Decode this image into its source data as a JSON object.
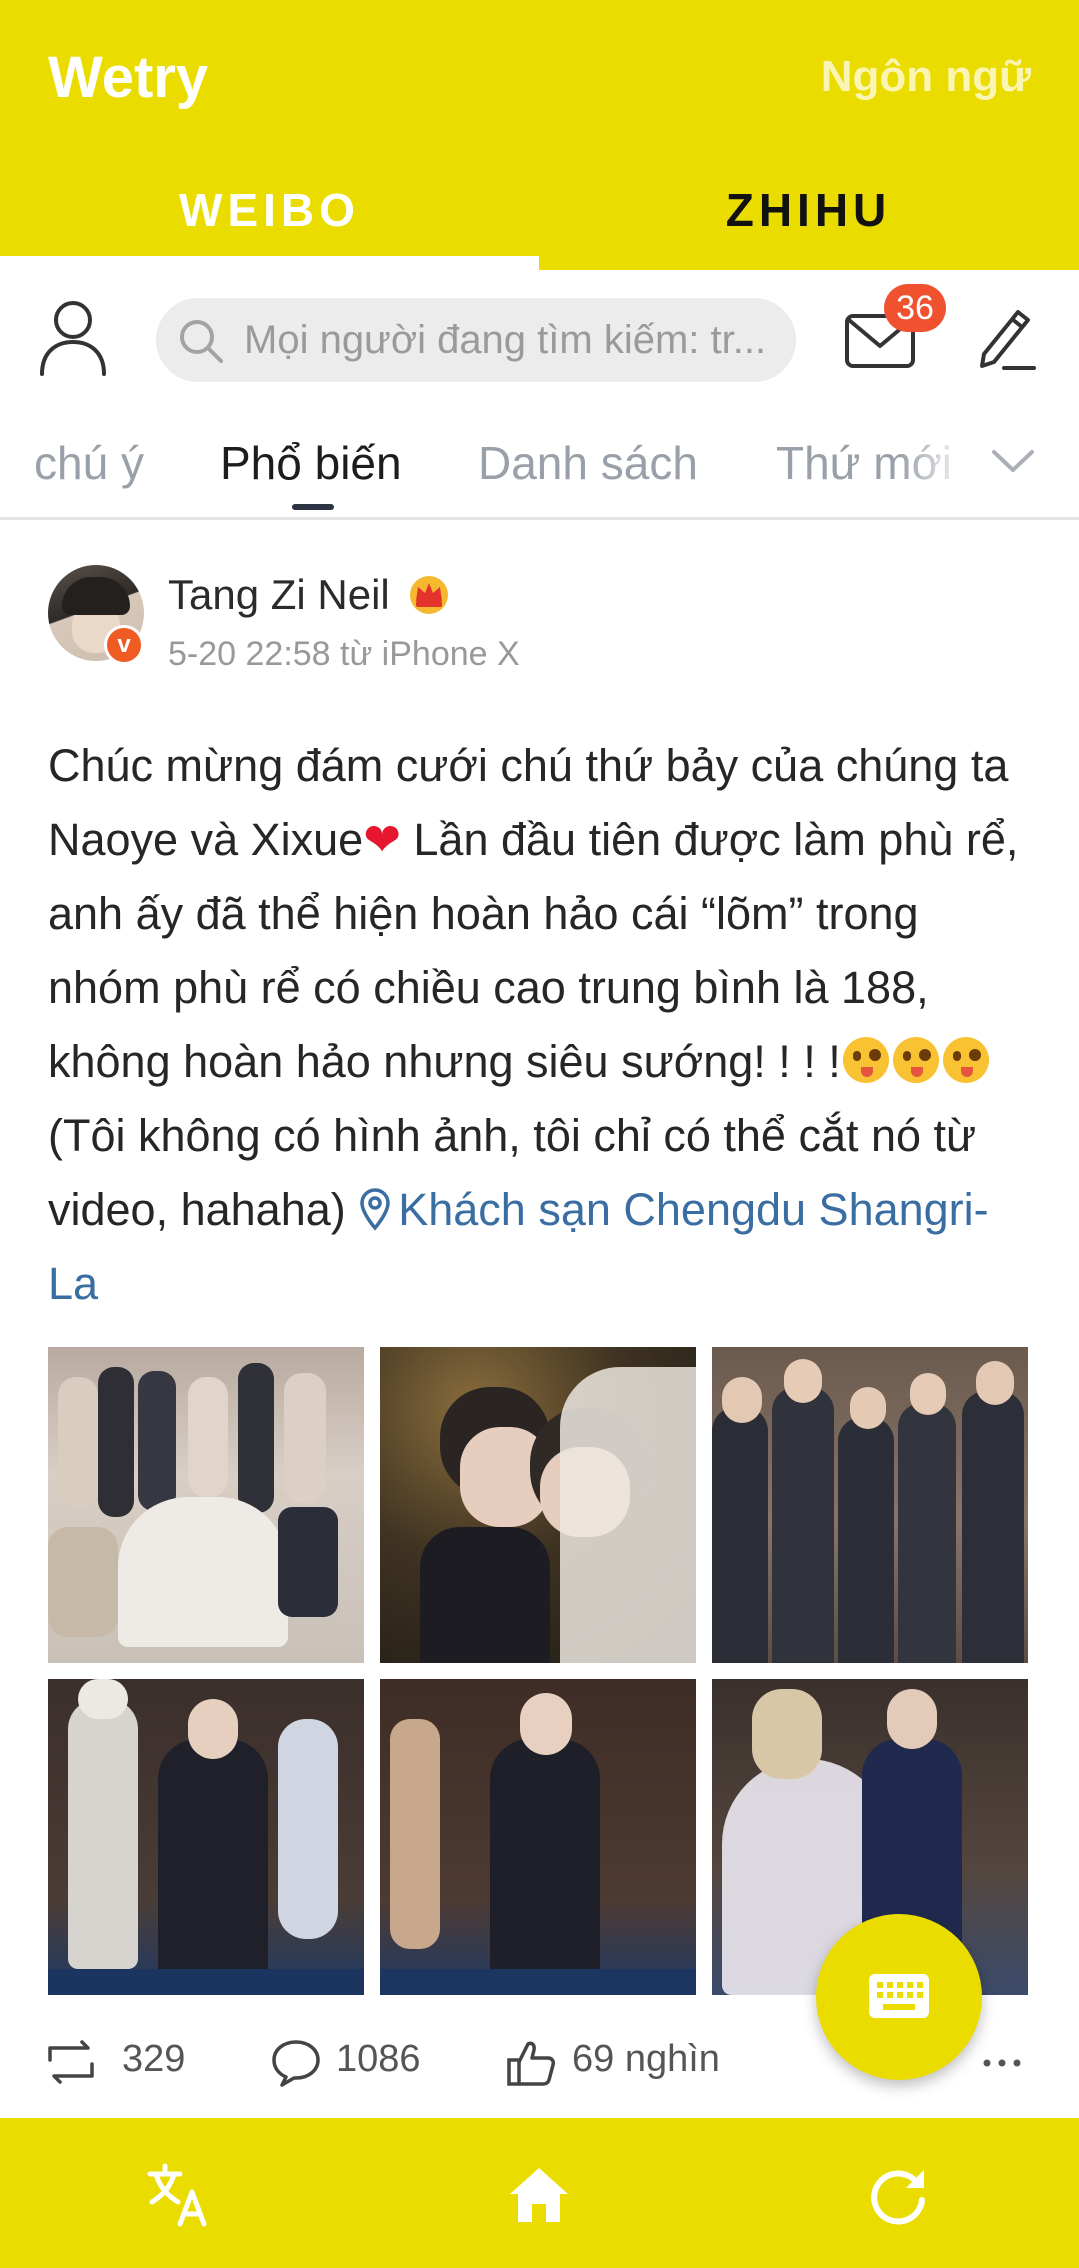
{
  "app": {
    "title": "Wetry",
    "language_button": "Ngôn ngữ"
  },
  "tabs": [
    {
      "label": "WEIBO",
      "active": true
    },
    {
      "label": "ZHIHU",
      "active": false
    }
  ],
  "toolbar": {
    "search_placeholder": "Mọi người đang tìm kiếm: tr...",
    "mail_badge": "36",
    "icons": [
      "user-icon",
      "search-icon",
      "mail-icon",
      "edit-icon"
    ]
  },
  "categories": {
    "items": [
      "chú ý",
      "Phổ biến",
      "Danh sách",
      "Thứ mới"
    ],
    "active": "Phổ biến"
  },
  "post": {
    "author": "Tang Zi Neil",
    "verified_mark": "v",
    "meta": "5-20 22:58 từ iPhone X",
    "text_1": "Chúc mừng đám cưới chú thứ bảy của chúng ta Naoye và Xixue",
    "heart": "❤",
    "text_2": " Lần đầu tiên được làm phù rể, anh ấy đã thể hiện hoàn hảo cái “lõm” trong nhóm phù rể có chiều cao trung bình là 188, không hoàn hảo nhưng siêu sướng! ! ! !",
    "text_3": "(Tôi không có hình ảnh, tôi chỉ có thể cắt nó từ video, hahaha) ",
    "location": "Khách sạn Chengdu Shangri-La",
    "photos": [
      "wedding-group-on-stairs",
      "couple-kissing-under-lights",
      "groomsmen-lineup",
      "groom-walking-with-guests",
      "groom-walking-alone",
      "bride-and-groom-dancing"
    ],
    "reposts": "329",
    "comments": "1086",
    "likes": "69 nghìn"
  },
  "bottom_nav": [
    "translate-icon",
    "home-icon",
    "refresh-icon"
  ],
  "colors": {
    "brand_yellow": "#ebdc00",
    "badge_red": "#f0522f",
    "link_blue": "#3a6ea2",
    "tab_active_text": "#ffffff",
    "tab_inactive_text": "#111111"
  }
}
